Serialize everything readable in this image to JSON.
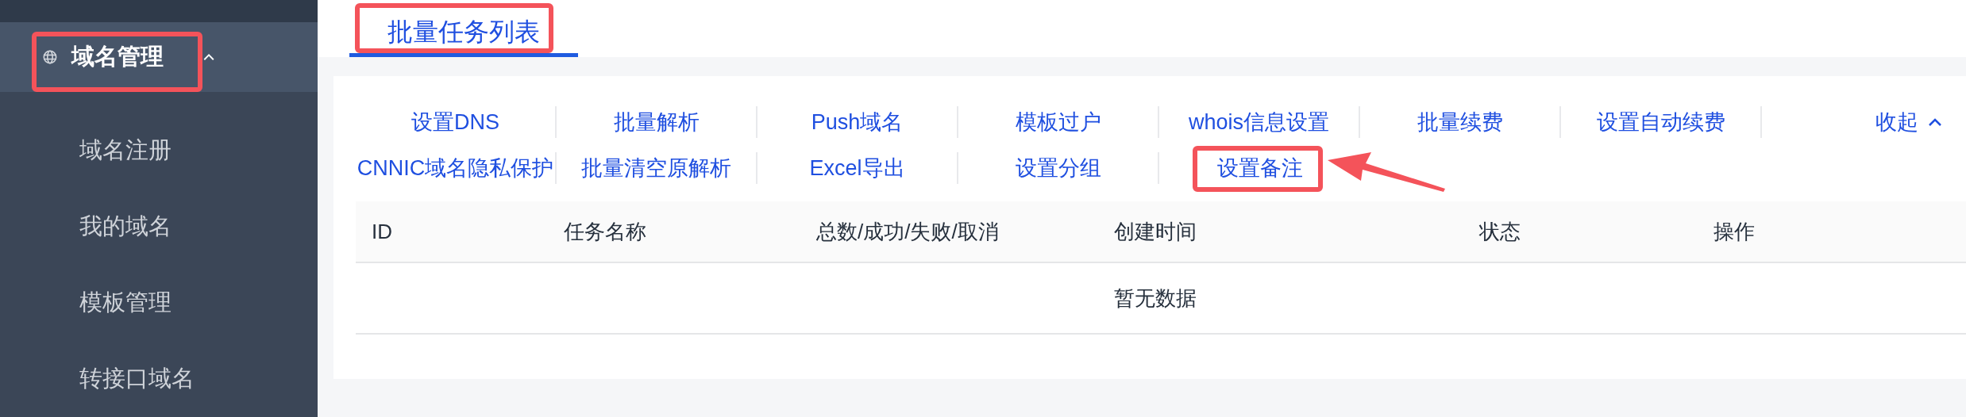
{
  "sidebar": {
    "groups": [
      {
        "label": "域名管理",
        "expanded": true,
        "selected": true,
        "children": [
          {
            "label": "域名注册",
            "selected": false
          },
          {
            "label": "我的域名",
            "selected": false
          },
          {
            "label": "模板管理",
            "selected": false
          },
          {
            "label": "转接口域名",
            "selected": false
          }
        ]
      }
    ]
  },
  "tabs": [
    {
      "label": "批量任务列表",
      "selected": true
    }
  ],
  "actions": [
    "设置DNS",
    "批量解析",
    "Push域名",
    "模板过户",
    "whois信息设置",
    "批量续费",
    "设置自动续费",
    "CNNIC域名隐私保护",
    "批量清空原解析",
    "Excel导出",
    "设置分组",
    "设置备注"
  ],
  "collapse": {
    "label": "收起",
    "expanded": true
  },
  "table": {
    "columns": [
      "ID",
      "任务名称",
      "总数/成功/失败/取消",
      "创建时间",
      "状态",
      "操作"
    ],
    "empty_text": "暂无数据"
  }
}
